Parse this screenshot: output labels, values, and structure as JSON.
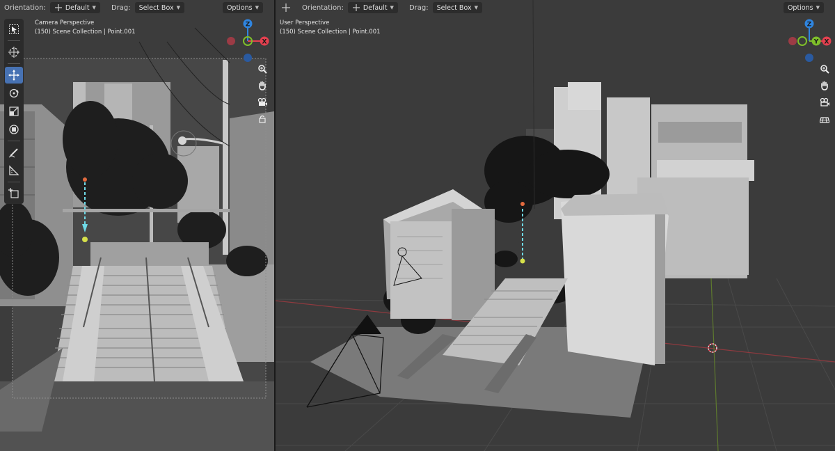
{
  "left_viewport": {
    "header": {
      "orientation_label": "Orientation:",
      "orientation_value": "Default",
      "drag_label": "Drag:",
      "drag_value": "Select Box",
      "options_label": "Options"
    },
    "overlay": {
      "view_name": "Camera Perspective",
      "collection_info": "(150) Scene Collection | Point.001"
    },
    "toolbar": [
      "select-box",
      "cursor",
      "move",
      "rotate",
      "scale",
      "transform",
      "annotate",
      "measure",
      "add-cube"
    ],
    "active_tool": "move",
    "nav_icons": [
      "zoom",
      "hand-pan",
      "camera",
      "lock"
    ],
    "gizmo_axes": [
      "Z",
      "X",
      "Y"
    ]
  },
  "right_viewport": {
    "header": {
      "orientation_label": "Orientation:",
      "orientation_value": "Default",
      "drag_label": "Drag:",
      "drag_value": "Select Box",
      "options_label": "Options"
    },
    "overlay": {
      "view_name": "User Perspective",
      "collection_info": "(150) Scene Collection | Point.001"
    },
    "nav_icons": [
      "zoom",
      "hand-pan",
      "camera-views",
      "grid"
    ],
    "gizmo_axes": [
      "Z",
      "X",
      "Y"
    ]
  },
  "colors": {
    "axis_x": "#e4404f",
    "axis_y": "#7fbf2a",
    "axis_z": "#2f85e0",
    "active_tool_bg": "#4772b3",
    "light_gizmo": "#6fd9e6"
  }
}
